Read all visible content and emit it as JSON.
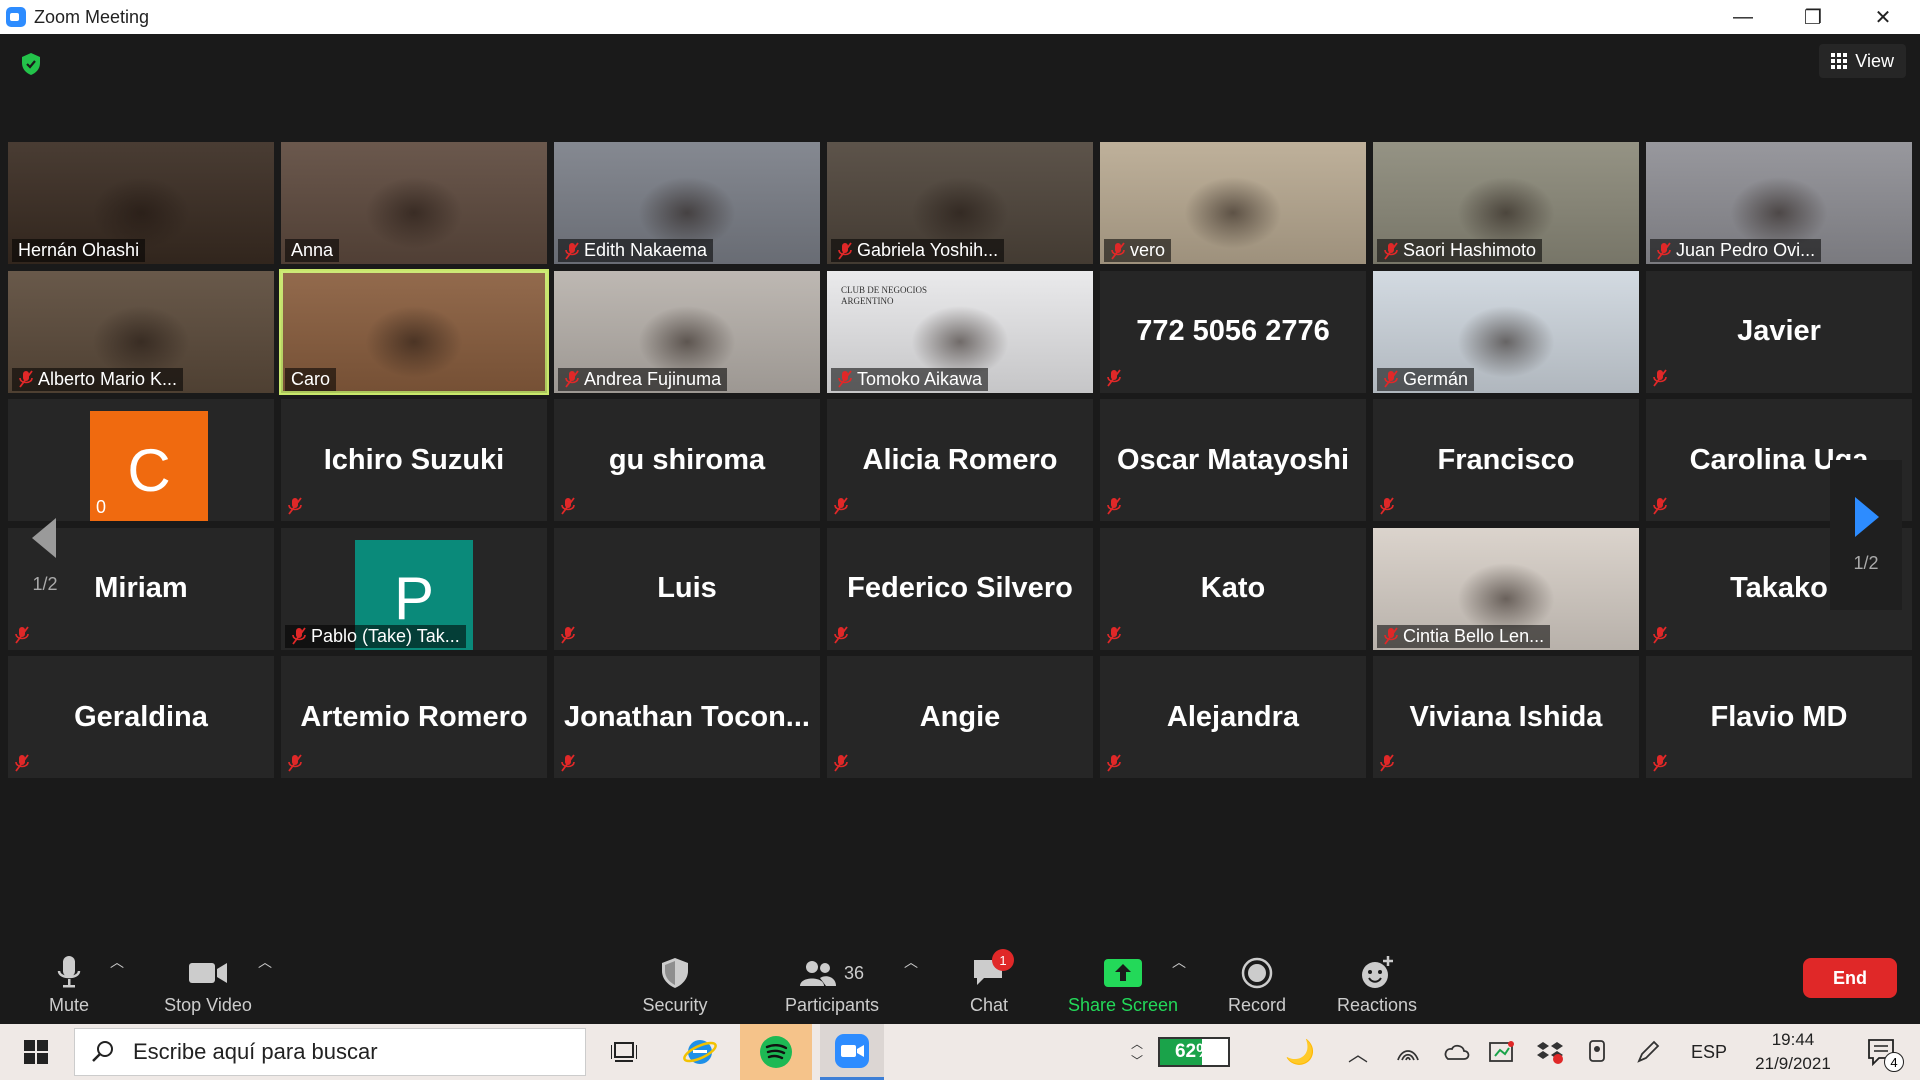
{
  "window": {
    "title": "Zoom Meeting"
  },
  "header": {
    "view_label": "View"
  },
  "grid": {
    "tiles": [
      {
        "name": "Hernán Ohashi",
        "type": "video",
        "muted": false,
        "bg": "#3a2c22"
      },
      {
        "name": "Anna",
        "type": "video",
        "muted": false,
        "bg": "#5e4a3e"
      },
      {
        "name": "Edith Nakaema",
        "type": "video",
        "muted": true,
        "bg": "#7b7f88"
      },
      {
        "name": "Gabriela Yoshih...",
        "type": "video",
        "muted": true,
        "bg": "#4f453b"
      },
      {
        "name": "vero",
        "type": "video",
        "muted": true,
        "bg": "#b9aa92"
      },
      {
        "name": "Saori Hashimoto",
        "type": "video",
        "muted": true,
        "bg": "#8c8a7a"
      },
      {
        "name": "Juan Pedro Ovi...",
        "type": "video",
        "muted": true,
        "bg": "#8f8f95"
      },
      {
        "name": "Alberto Mario K...",
        "type": "video",
        "muted": true,
        "bg": "#5c4b3b"
      },
      {
        "name": "Caro",
        "type": "video",
        "muted": false,
        "active": true,
        "bg": "#8a5e3e"
      },
      {
        "name": "Andrea Fujinuma",
        "type": "video",
        "muted": true,
        "bg": "#b8b2ac"
      },
      {
        "name": "Tomoko Aikawa",
        "type": "video",
        "muted": true,
        "bg": "#e8e8ea",
        "banner": "CLUB DE NEGOCIOS ARGENTINO"
      },
      {
        "name": "772 5056 2776",
        "type": "text",
        "muted": true
      },
      {
        "name": "Germán",
        "type": "video",
        "muted": true,
        "bg": "#cfd7df"
      },
      {
        "name": "Javier",
        "type": "text",
        "muted": true
      },
      {
        "name": "C",
        "type": "avatar",
        "label": "0",
        "avatar_color": "#f06a0f",
        "muted": false
      },
      {
        "name": "Ichiro Suzuki",
        "type": "text",
        "muted": true
      },
      {
        "name": "gu shiroma",
        "type": "text",
        "muted": true
      },
      {
        "name": "Alicia Romero",
        "type": "text",
        "muted": true
      },
      {
        "name": "Oscar Matayoshi",
        "type": "text",
        "muted": true
      },
      {
        "name": "Francisco",
        "type": "text",
        "muted": true
      },
      {
        "name": "Carolina  Uga",
        "type": "text",
        "muted": true
      },
      {
        "name": "Miriam",
        "type": "text",
        "muted": true
      },
      {
        "name": "P",
        "type": "avatar",
        "label": "Pablo (Take) Tak...",
        "avatar_color": "#0a8a7a",
        "muted": true
      },
      {
        "name": "Luis",
        "type": "text",
        "muted": true
      },
      {
        "name": "Federico Silvero",
        "type": "text",
        "muted": true
      },
      {
        "name": "Kato",
        "type": "text",
        "muted": true
      },
      {
        "name": "Cintia Bello Len...",
        "type": "video",
        "muted": true,
        "bg": "#d8d0c8"
      },
      {
        "name": "Takako",
        "type": "text",
        "muted": true
      },
      {
        "name": "Geraldina",
        "type": "text",
        "muted": true
      },
      {
        "name": "Artemio Romero",
        "type": "text",
        "muted": true
      },
      {
        "name": "Jonathan  Tocon...",
        "type": "text",
        "muted": true
      },
      {
        "name": "Angie",
        "type": "text",
        "muted": true
      },
      {
        "name": "Alejandra",
        "type": "text",
        "muted": true
      },
      {
        "name": "Viviana Ishida",
        "type": "text",
        "muted": true
      },
      {
        "name": "Flavio MD",
        "type": "text",
        "muted": true
      }
    ],
    "prev_page": "1/2",
    "next_page": "1/2"
  },
  "toolbar": {
    "mute": "Mute",
    "stop_video": "Stop Video",
    "security": "Security",
    "participants": "Participants",
    "participants_count": "36",
    "chat": "Chat",
    "chat_badge": "1",
    "share_screen": "Share Screen",
    "record": "Record",
    "reactions": "Reactions",
    "end": "End"
  },
  "taskbar": {
    "search_placeholder": "Escribe aquí para buscar",
    "battery": "62%",
    "language": "ESP",
    "time": "19:44",
    "date": "21/9/2021",
    "notifications": "4"
  },
  "colors": {
    "share_green": "#23d959",
    "end_red": "#e02828",
    "active_outline": "#c9e86c",
    "next_arrow": "#2d8cff"
  }
}
